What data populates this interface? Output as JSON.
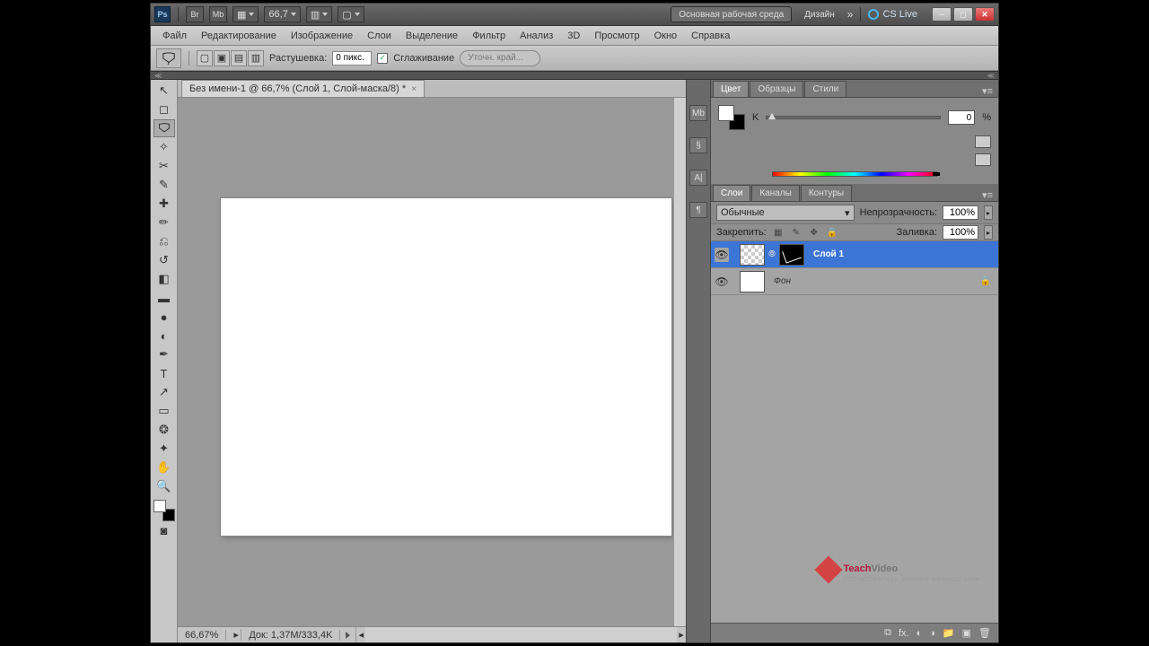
{
  "titlebar": {
    "zoom_dd": "66,7",
    "workspace_main": "Основная рабочая среда",
    "workspace_design": "Дизайн",
    "cslive": "CS Live"
  },
  "menu": [
    "Файл",
    "Редактирование",
    "Изображение",
    "Слои",
    "Выделение",
    "Фильтр",
    "Анализ",
    "3D",
    "Просмотр",
    "Окно",
    "Справка"
  ],
  "options": {
    "feather_label": "Растушевка:",
    "feather_value": "0 пикс.",
    "antialias_label": "Сглаживание",
    "refine_label": "Уточн. край..."
  },
  "doc_tab": "Без имени-1 @ 66,7% (Слой 1, Слой-маска/8) *",
  "status": {
    "zoom": "66,67%",
    "docsize": "Док: 1,37M/333,4K"
  },
  "dock_mini": [
    "Mb",
    "§",
    "A|",
    "¶"
  ],
  "color_panel": {
    "tabs": [
      "Цвет",
      "Образцы",
      "Стили"
    ],
    "channel": "K",
    "value": "0",
    "pct": "%"
  },
  "layers_panel": {
    "tabs": [
      "Слои",
      "Каналы",
      "Контуры"
    ],
    "blend": "Обычные",
    "opacity_label": "Непрозрачность:",
    "opacity": "100%",
    "lock_label": "Закрепить:",
    "fill_label": "Заливка:",
    "fill": "100%",
    "layers": [
      {
        "name": "Слой 1",
        "selected": true,
        "mask": true
      },
      {
        "name": "Фон",
        "selected": false,
        "locked": true,
        "italic": true
      }
    ]
  },
  "watermark": {
    "brand1": "Teach",
    "brand2": "Video",
    "sub": "ПОСМОТРИ КАК ЗНАНИЯ МЕНЯЮТ МИР"
  }
}
